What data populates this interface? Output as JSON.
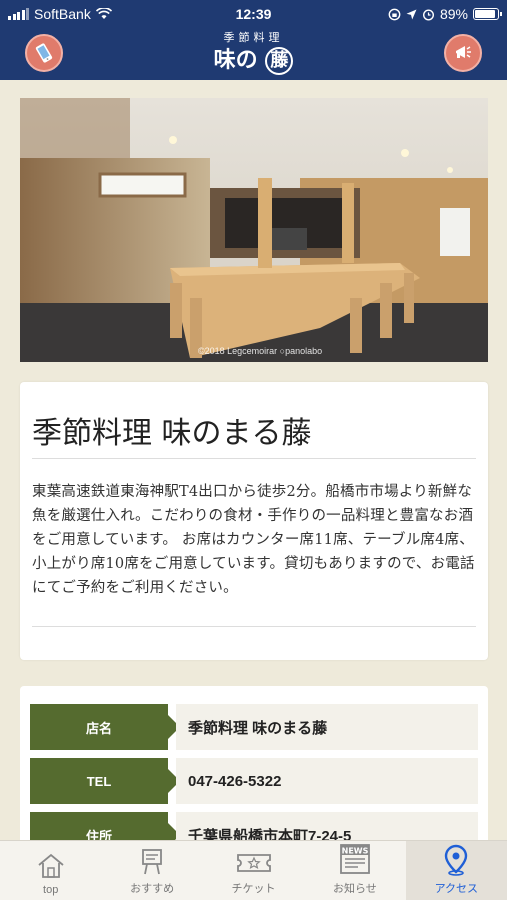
{
  "status_bar": {
    "carrier": "SoftBank",
    "time": "12:39",
    "battery": "89%"
  },
  "header": {
    "logo_sub": "季節料理",
    "logo_main": "味の",
    "logo_circle": "藤"
  },
  "photo": {
    "credit": "©2018 Legcemoirar  ○panolabo"
  },
  "shop": {
    "title": "季節料理 味のまる藤",
    "description": "東葉高速鉄道東海神駅T4出口から徒歩2分。船橋市市場より新鮮な魚を厳選仕入れ。こだわりの食材・手作りの一品料理と豊富なお酒をご用意しています。 お席はカウンター席11席、テーブル席4席、小上がり席10席をご用意しています。貸切もありますので、お電話にてご予約をご利用ください。"
  },
  "details": [
    {
      "label": "店名",
      "value": "季節料理 味のまる藤"
    },
    {
      "label": "TEL",
      "value": "047-426-5322"
    },
    {
      "label": "住所",
      "value": "千葉県船橋市本町7-24-5"
    }
  ],
  "tabs": [
    {
      "label": "top",
      "icon": "home-icon"
    },
    {
      "label": "おすすめ",
      "icon": "signboard-icon"
    },
    {
      "label": "チケット",
      "icon": "ticket-icon"
    },
    {
      "label": "お知らせ",
      "icon": "news-icon"
    },
    {
      "label": "アクセス",
      "icon": "map-pin-icon"
    }
  ],
  "colors": {
    "header": "#1f3a72",
    "accent_active": "#1f5fd6",
    "label_bg": "#556b2f",
    "header_button": "#e07b6b"
  }
}
